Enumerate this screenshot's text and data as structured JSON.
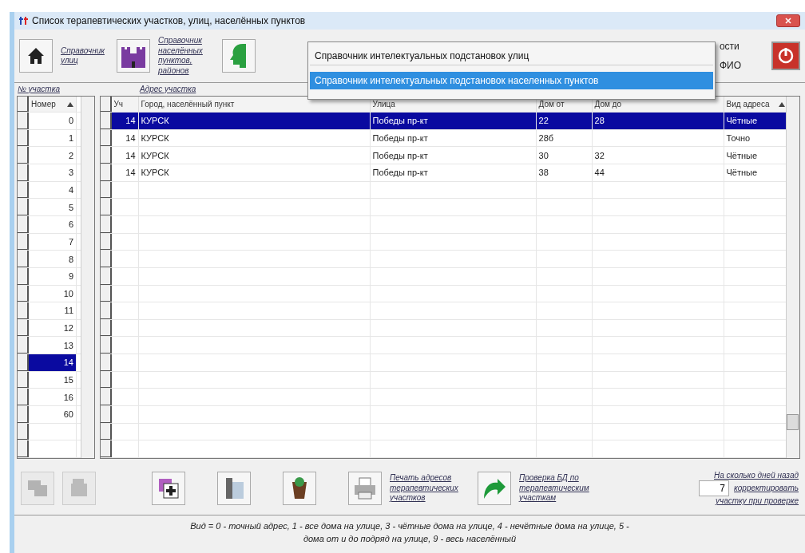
{
  "window": {
    "title": "Список терапевтических участков, улиц, населённых пунктов"
  },
  "toolbar": {
    "links": [
      "Справочник улиц",
      "Справочник населённых пунктов, районов"
    ],
    "partial_labels": [
      "ости",
      "ФИО"
    ]
  },
  "menu": {
    "items": [
      {
        "label": "Справочник интелектуальных подстановок улиц",
        "selected": false
      },
      {
        "label": "Справочник интелектуальных подстановок населенных пунктов",
        "selected": true
      }
    ]
  },
  "section_labels": [
    "№ участка",
    "Адрес участка"
  ],
  "districts": {
    "column": "Номер",
    "rows": [
      {
        "number": "0",
        "selected": false
      },
      {
        "number": "1",
        "selected": false
      },
      {
        "number": "2",
        "selected": false
      },
      {
        "number": "3",
        "selected": false
      },
      {
        "number": "4",
        "selected": false
      },
      {
        "number": "5",
        "selected": false
      },
      {
        "number": "6",
        "selected": false
      },
      {
        "number": "7",
        "selected": false
      },
      {
        "number": "8",
        "selected": false
      },
      {
        "number": "9",
        "selected": false
      },
      {
        "number": "10",
        "selected": false
      },
      {
        "number": "11",
        "selected": false
      },
      {
        "number": "12",
        "selected": false
      },
      {
        "number": "13",
        "selected": false
      },
      {
        "number": "14",
        "selected": true
      },
      {
        "number": "15",
        "selected": false
      },
      {
        "number": "16",
        "selected": false
      },
      {
        "number": "60",
        "selected": false
      }
    ]
  },
  "addresses": {
    "columns": [
      "Уч",
      "Город, населённый пункт",
      "Улица",
      "Дом от",
      "Дом до",
      "Вид адреса"
    ],
    "rows": [
      {
        "cells": [
          "14",
          "КУРСК",
          "Победы пр-кт",
          "22",
          "28",
          "Чётные"
        ],
        "selected": true
      },
      {
        "cells": [
          "14",
          "КУРСК",
          "Победы пр-кт",
          "28б",
          "",
          "Точно"
        ],
        "selected": false
      },
      {
        "cells": [
          "14",
          "КУРСК",
          "Победы пр-кт",
          "30",
          "32",
          "Чётные"
        ],
        "selected": false
      },
      {
        "cells": [
          "14",
          "КУРСК",
          "Победы пр-кт",
          "38",
          "44",
          "Чётные"
        ],
        "selected": false
      }
    ]
  },
  "bottom_toolbar": {
    "buttons": [
      {
        "disabled": true
      },
      {
        "disabled": true
      },
      {
        "disabled": false
      },
      {
        "disabled": false
      },
      {
        "disabled": false
      }
    ],
    "print_link": "Печать адресов терапевтических участков",
    "check_link": "Проверка БД по терапевтическим участкам",
    "days": {
      "caption": "На сколько дней назад",
      "value": "7",
      "label": "корректировать",
      "note": "участку при проверке"
    }
  },
  "legend": "Вид = 0 - точный адрес, 1 - все дома на улице, 3 - чётные дома на улице, 4 - нечётные дома на улице, 5 - дома от и до подряд на улице, 9 - весь населённый"
}
